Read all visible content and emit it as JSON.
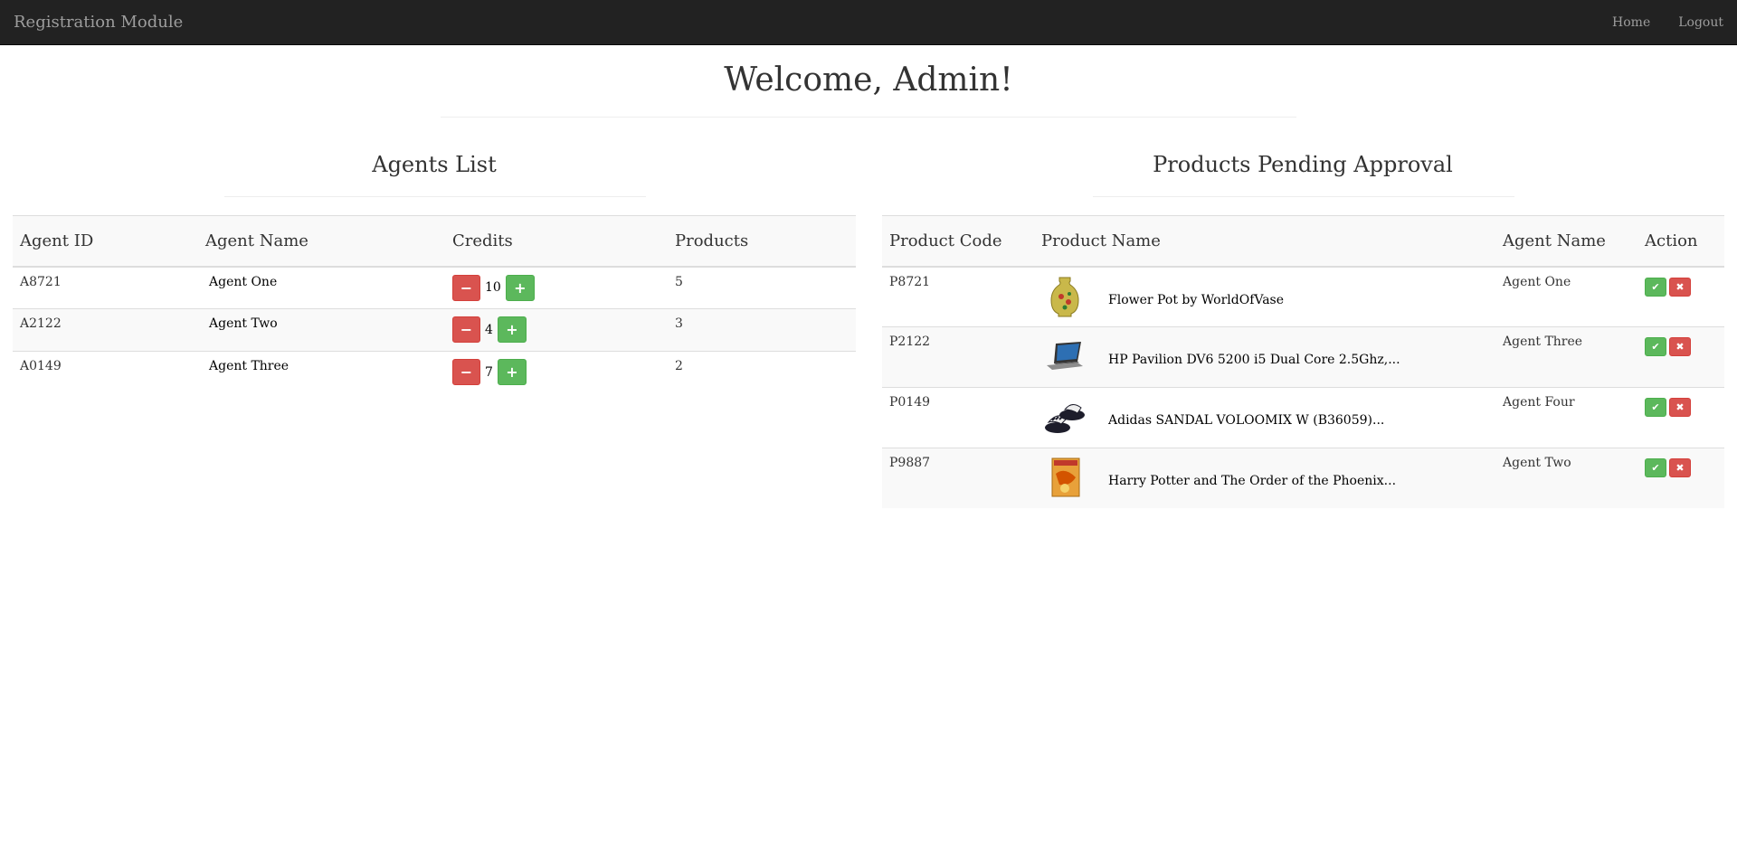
{
  "navbar": {
    "brand": "Registration Module",
    "links": [
      "Home",
      "Logout"
    ]
  },
  "welcome": "Welcome, Admin!",
  "agents": {
    "title": "Agents List",
    "headers": [
      "Agent ID",
      "Agent Name",
      "Credits",
      "Products"
    ],
    "rows": [
      {
        "id": "A8721",
        "name": "Agent One",
        "credits": "10",
        "products": "5"
      },
      {
        "id": "A2122",
        "name": "Agent Two",
        "credits": "4",
        "products": "3"
      },
      {
        "id": "A0149",
        "name": "Agent Three",
        "credits": "7",
        "products": "2"
      }
    ],
    "minus_icon": "minus-icon",
    "plus_icon": "plus-icon"
  },
  "products": {
    "title": "Products Pending Approval",
    "headers": [
      "Product Code",
      "Product Name",
      "Agent Name",
      "Action"
    ],
    "rows": [
      {
        "code": "P8721",
        "name": "Flower Pot by WorldOfVase",
        "agent": "Agent One",
        "thumb": "vase-image"
      },
      {
        "code": "P2122",
        "name": "HP Pavilion DV6 5200 i5 Dual Core 2.5Ghz,...",
        "agent": "Agent Three",
        "thumb": "laptop-image"
      },
      {
        "code": "P0149",
        "name": "Adidas SANDAL VOLOOMIX W (B36059)...",
        "agent": "Agent Four",
        "thumb": "sandal-image"
      },
      {
        "code": "P9887",
        "name": "Harry Potter and The Order of the Phoenix...",
        "agent": "Agent Two",
        "thumb": "book-image"
      }
    ],
    "approve_icon": "check-icon",
    "reject_icon": "close-icon"
  },
  "colors": {
    "navbar_bg": "#222222",
    "navbar_text": "#9d9d9d",
    "danger": "#d9534f",
    "success": "#5cb85c"
  }
}
